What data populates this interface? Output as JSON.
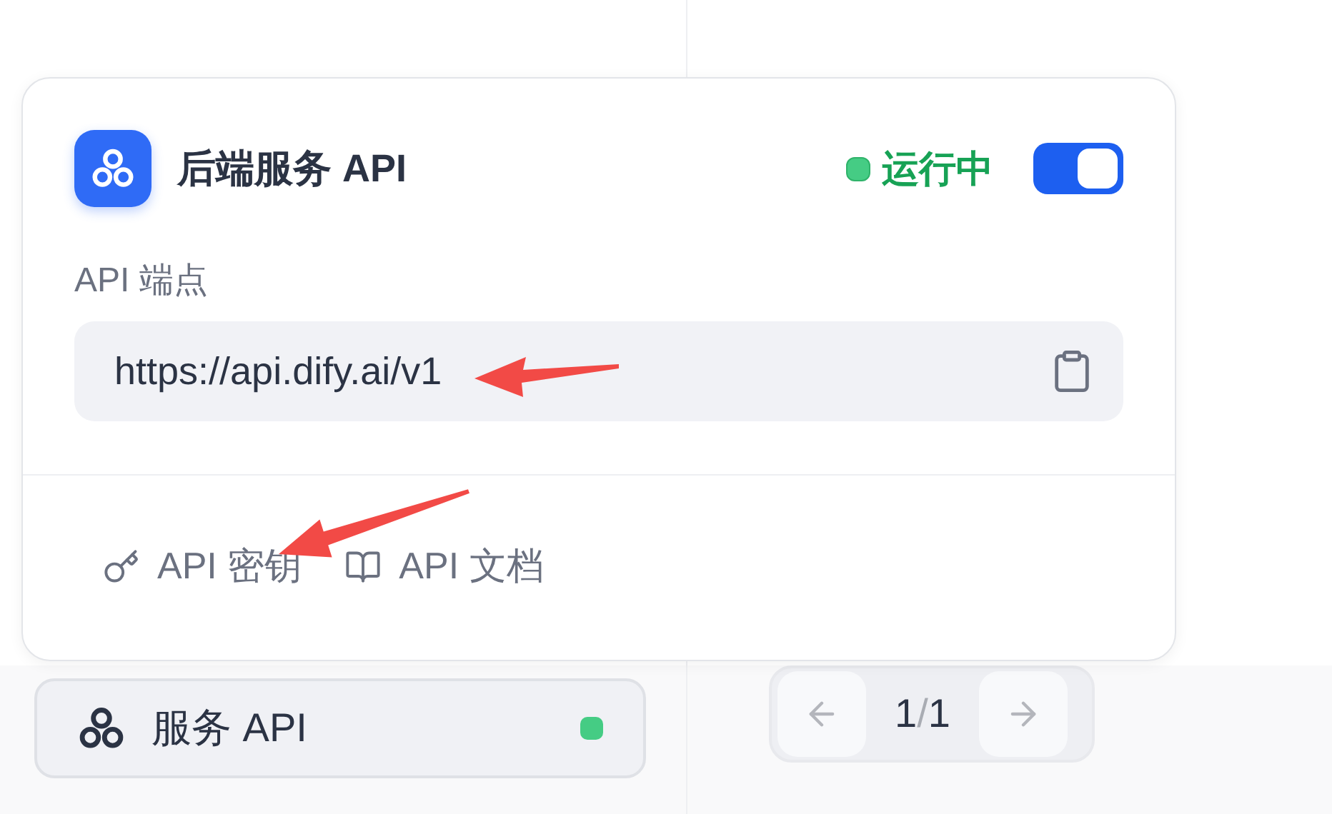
{
  "card": {
    "title": "后端服务 API",
    "status": {
      "label": "运行中",
      "color": "#45cc84"
    },
    "toggle": {
      "on": true
    },
    "endpoint": {
      "label": "API 端点",
      "value": "https://api.dify.ai/v1"
    },
    "actions": [
      {
        "label": "API 密钥",
        "kind": "key"
      },
      {
        "label": "API 文档",
        "kind": "book"
      }
    ]
  },
  "service_button": {
    "label": "服务 API",
    "color": "#45cc84"
  },
  "pagination": {
    "page": "1",
    "separator": "/",
    "total": "1"
  }
}
